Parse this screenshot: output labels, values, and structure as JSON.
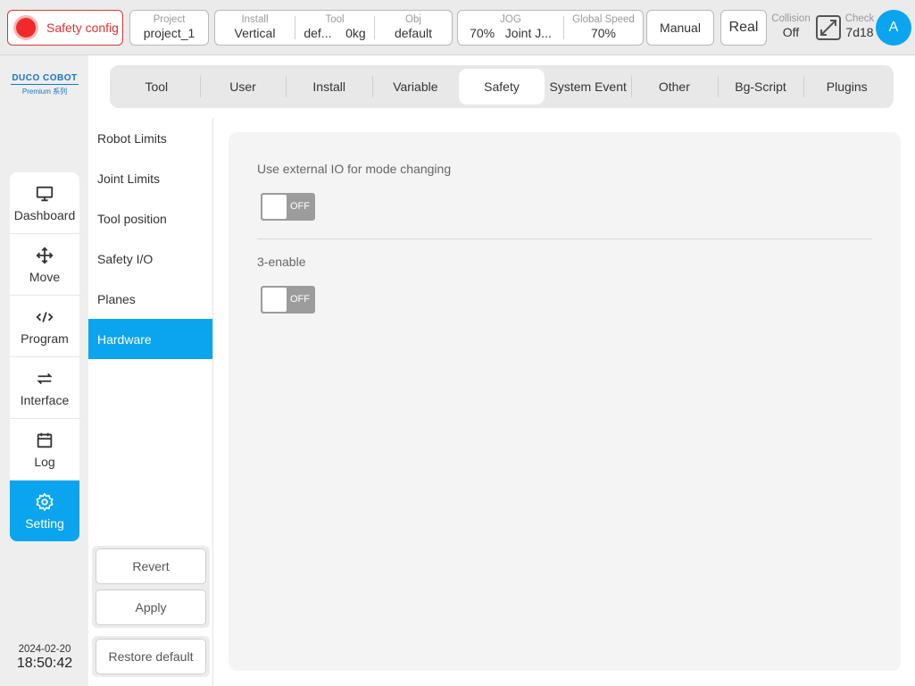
{
  "topbar": {
    "safety_label": "Safety config",
    "project": {
      "label": "Project",
      "value": "project_1"
    },
    "install": {
      "label": "Install",
      "value": "Vertical"
    },
    "tool": {
      "label": "Tool",
      "name": "def...",
      "weight": "0kg"
    },
    "obj": {
      "label": "Obj",
      "value": "default"
    },
    "jog": {
      "label": "JOG",
      "percent": "70%",
      "mode": "Joint J..."
    },
    "global_speed": {
      "label": "Global Speed",
      "value": "70%"
    },
    "mode_button": "Manual",
    "real_button": "Real",
    "collision": {
      "label": "Collision",
      "value": "Off"
    },
    "check": {
      "label": "Check",
      "value": "7d18"
    },
    "avatar_letter": "A"
  },
  "brand": {
    "name": "DUCO COBOT",
    "edition": "Premium 系列",
    "color": "#1a73c9"
  },
  "nav": {
    "items": [
      {
        "label": "Dashboard",
        "icon": "monitor-icon"
      },
      {
        "label": "Move",
        "icon": "move-arrows-icon"
      },
      {
        "label": "Program",
        "icon": "code-icon"
      },
      {
        "label": "Interface",
        "icon": "swap-icon"
      },
      {
        "label": "Log",
        "icon": "calendar-icon"
      },
      {
        "label": "Setting",
        "icon": "gear-icon",
        "active": true
      }
    ]
  },
  "datetime": {
    "date": "2024-02-20",
    "time": "18:50:42"
  },
  "tabs": [
    "Tool",
    "User",
    "Install",
    "Variable",
    "Safety",
    "System Event",
    "Other",
    "Bg-Script",
    "Plugins"
  ],
  "active_tab": "Safety",
  "subnav": {
    "items": [
      "Robot Limits",
      "Joint Limits",
      "Tool position",
      "Safety I/O",
      "Planes",
      "Hardware"
    ],
    "active": "Hardware",
    "revert": "Revert",
    "apply": "Apply",
    "restore": "Restore default"
  },
  "panel": {
    "external_io_label": "Use external IO for mode changing",
    "external_io_state": "OFF",
    "three_enable_label": "3-enable",
    "three_enable_state": "OFF"
  },
  "colors": {
    "accent": "#0aa5ee",
    "safety": "#e53030",
    "toggle_off": "#9c9c9c"
  }
}
